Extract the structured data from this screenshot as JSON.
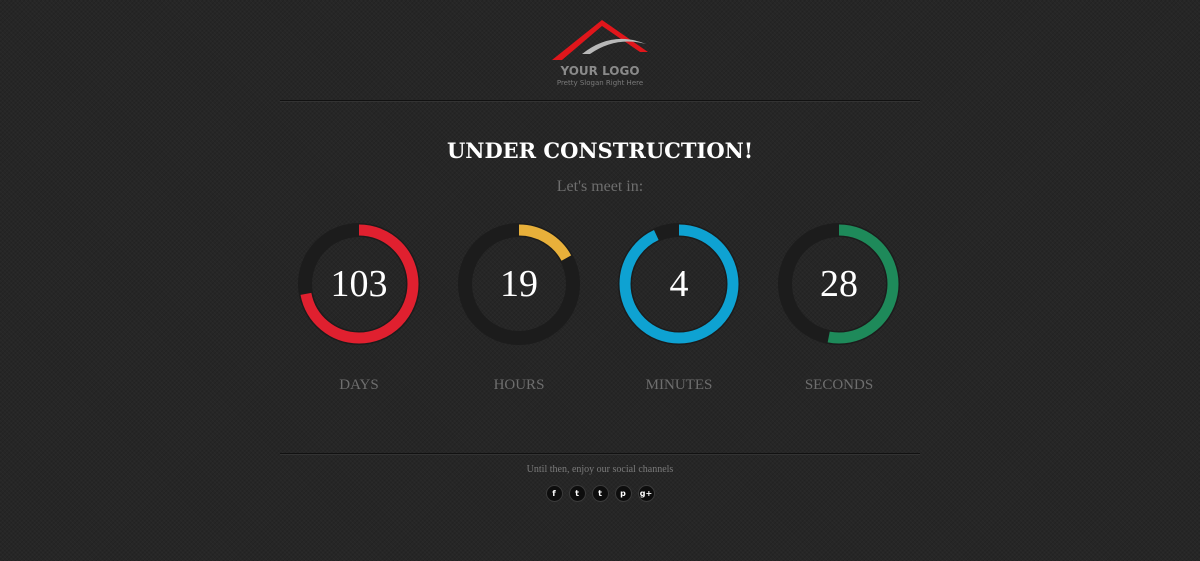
{
  "logo": {
    "title": "YOUR LOGO",
    "slogan": "Pretty Slogan Right Here",
    "colors": {
      "primary": "#e0161b",
      "secondary": "#b8b8b8"
    }
  },
  "headline": "UNDER CONSTRUCTION!",
  "subtitle": "Let's meet in:",
  "countdown": [
    {
      "id": "days",
      "value": "103",
      "label": "DAYS",
      "fraction": 0.72,
      "color": "#e0202f"
    },
    {
      "id": "hours",
      "value": "19",
      "label": "HOURS",
      "fraction": 0.17,
      "color": "#e8b03a"
    },
    {
      "id": "minutes",
      "value": "4",
      "label": "MINUTES",
      "fraction": 0.93,
      "color": "#0ea2d2"
    },
    {
      "id": "seconds",
      "value": "28",
      "label": "SECONDS",
      "fraction": 0.53,
      "color": "#1e8a5a"
    }
  ],
  "ring_track_color": "#1c1c1c",
  "footer": {
    "note": "Until then, enjoy our social channels",
    "social": [
      {
        "name": "facebook",
        "glyph": "f",
        "icon": "facebook-icon"
      },
      {
        "name": "twitter",
        "glyph": "t",
        "icon": "twitter-icon"
      },
      {
        "name": "tumblr",
        "glyph": "t",
        "icon": "tumblr-icon"
      },
      {
        "name": "pinterest",
        "glyph": "p",
        "icon": "pinterest-icon"
      },
      {
        "name": "googleplus",
        "glyph": "g+",
        "icon": "google-plus-icon"
      }
    ]
  }
}
